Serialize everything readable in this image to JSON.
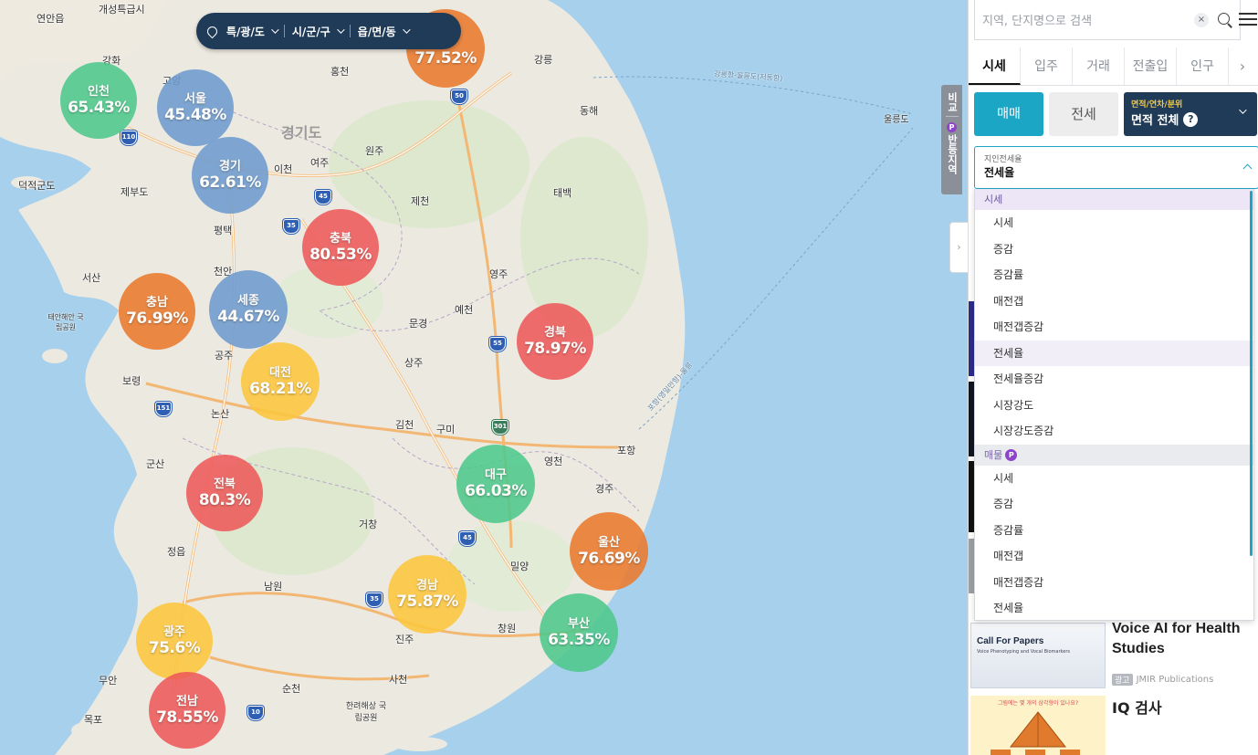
{
  "region_filter": {
    "province": "특/광/도",
    "city": "시/군/구",
    "town": "읍/면/동"
  },
  "bubbles": [
    {
      "name": "",
      "value": "77.52%",
      "color": "#ea7a2e"
    },
    {
      "name": "인천",
      "value": "65.43%",
      "color": "#4ec98c"
    },
    {
      "name": "서울",
      "value": "45.48%",
      "color": "#6f9ccf"
    },
    {
      "name": "경기",
      "value": "62.61%",
      "color": "#6f9ccf"
    },
    {
      "name": "충북",
      "value": "80.53%",
      "color": "#ee5a5a"
    },
    {
      "name": "충남",
      "value": "76.99%",
      "color": "#ea7a2e"
    },
    {
      "name": "세종",
      "value": "44.67%",
      "color": "#6f9ccf"
    },
    {
      "name": "경북",
      "value": "78.97%",
      "color": "#ee5a5a"
    },
    {
      "name": "대전",
      "value": "68.21%",
      "color": "#fcc63e"
    },
    {
      "name": "전북",
      "value": "80.3%",
      "color": "#ee5a5a"
    },
    {
      "name": "대구",
      "value": "66.03%",
      "color": "#4ec98c"
    },
    {
      "name": "울산",
      "value": "76.69%",
      "color": "#ea7a2e"
    },
    {
      "name": "경남",
      "value": "75.87%",
      "color": "#fcc63e"
    },
    {
      "name": "부산",
      "value": "63.35%",
      "color": "#4ec98c"
    },
    {
      "name": "광주",
      "value": "75.6%",
      "color": "#fcc63e"
    },
    {
      "name": "전남",
      "value": "78.55%",
      "color": "#ee5a5a"
    }
  ],
  "places": {
    "yeonan": "연안읍",
    "gaeseong": "개성특급시",
    "ganghwa": "강화",
    "gimpo": "고양",
    "hongcheon": "홍천",
    "gangneung": "강릉",
    "donghae": "동해",
    "wonju": "원주",
    "icheon": "이천",
    "yeoju": "여주",
    "gyeonggido": "경기도",
    "jecheon": "제천",
    "taebaek": "태백",
    "pyeongtaek": "평택",
    "cheonan": "천안",
    "seosan": "서산",
    "yeongju": "영주",
    "yecheon": "예천",
    "mungyeong": "문경",
    "sangju": "상주",
    "gongju": "공주",
    "boryeong": "보령",
    "nonsan": "논산",
    "gimcheon": "김천",
    "gumi": "구미",
    "pohang": "포항",
    "yeongcheon": "영천",
    "gyeongju": "경주",
    "gunsan": "군산",
    "geochang": "거창",
    "miryang": "밀양",
    "jeongeup": "정읍",
    "namwon": "남원",
    "jinju": "진주",
    "changwon": "창원",
    "muan": "무안",
    "mokpo": "목포",
    "suncheon": "순천",
    "sacheon": "사천",
    "hallyeo": "한려해상 국립공원",
    "deokjeok": "덕적군도",
    "jebudo": "제부도",
    "taean": "태안해안 국립공원",
    "ulleung": "울릉도",
    "sea_route": "강릉항-울릉도(저동항)",
    "sea_route2": "포항(영일만항)-울릉"
  },
  "highways": {
    "h110": "110",
    "h50": "50",
    "h45": "45",
    "h35a": "35",
    "h55": "55",
    "h151": "151",
    "h301": "301",
    "h45b": "45",
    "h35b": "35",
    "h10": "10"
  },
  "side_tabs": {
    "compare": "비교",
    "p_badge": "P",
    "flip_region": "반등지역",
    "collapse": "›"
  },
  "panel": {
    "search_placeholder": "지역, 단지명으로 검색",
    "clear": "×",
    "tabs": [
      "시세",
      "입주",
      "거래",
      "전출입",
      "인구",
      "›"
    ],
    "trade_sale": "매매",
    "trade_jeonse": "전세",
    "area_small": "면적/연차/분위",
    "area_main": "면적 전체",
    "area_help": "?",
    "metric_label": "지인전세율",
    "metric_value": "전세율",
    "dropdown": {
      "group1": "시세",
      "items1": [
        "시세",
        "증감",
        "증감률",
        "매전갭",
        "매전갭증감",
        "전세율",
        "전세율증감",
        "시장강도",
        "시장강도증감"
      ],
      "group2": "매물",
      "group2_badge": "P",
      "items2": [
        "시세",
        "증감",
        "증감률",
        "매전갭",
        "매전갭증감",
        "전세율"
      ]
    },
    "ad1": {
      "image_title": "Call For Papers",
      "image_sub": "Voice Phenotyping and Vocal Biomarkers",
      "title": "Voice AI for Health Studies",
      "badge": "광고",
      "advertiser": "JMIR Publications"
    },
    "ad2": {
      "image_header": "그림에는 몇 개의 삼각형이 있나요?",
      "title": "IQ 검사"
    }
  }
}
